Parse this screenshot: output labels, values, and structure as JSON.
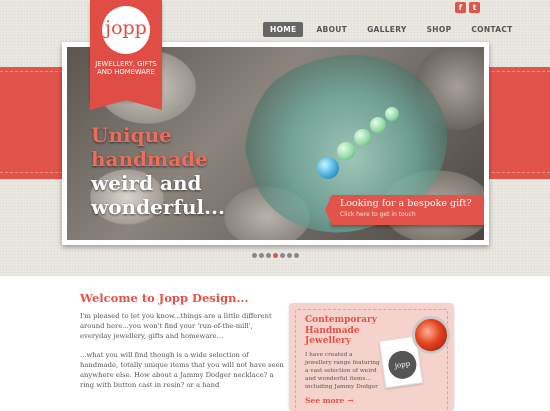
{
  "brand": {
    "logo_text": "jopp",
    "tagline": "JEWELLERY, GIFTS AND HOMEWARE",
    "accent_color": "#e2534a"
  },
  "social": [
    {
      "icon": "facebook-icon",
      "glyph": "f"
    },
    {
      "icon": "twitter-icon",
      "glyph": "t"
    }
  ],
  "nav": {
    "items": [
      {
        "label": "HOME",
        "active": true
      },
      {
        "label": "ABOUT",
        "active": false
      },
      {
        "label": "GALLERY",
        "active": false
      },
      {
        "label": "SHOP",
        "active": false
      },
      {
        "label": "CONTACT",
        "active": false
      }
    ]
  },
  "hero": {
    "headline_line1": "Unique",
    "headline_line2": "handmade",
    "headline_line3": "weird and",
    "headline_line4": "wonderful...",
    "cta_title": "Looking for a bespoke gift?",
    "cta_subtitle": "Click here to get in touch",
    "slide_count": 7,
    "active_slide": 3
  },
  "main": {
    "welcome_heading": "Welcome to Jopp Design...",
    "paragraph1": "I'm pleased to let you know...things are a little different around here...you won't find your 'run-of-the-mill', everyday jewellery, gifts and homeware...",
    "paragraph2": "...what you will find though is a wide selection of handmade, totally unique items that you will not have seen anywhere else. How about a Jammy Dodger necklace? a ring with button cast in resin? or a hand"
  },
  "feature_card": {
    "title": "Contemporary Handmade Jewellery",
    "text": "I have created a jewellery range featuring a vast selection of weird and wonderful items... including Jammy Dodger",
    "link_label": "See more",
    "tag_text": "jopp"
  }
}
